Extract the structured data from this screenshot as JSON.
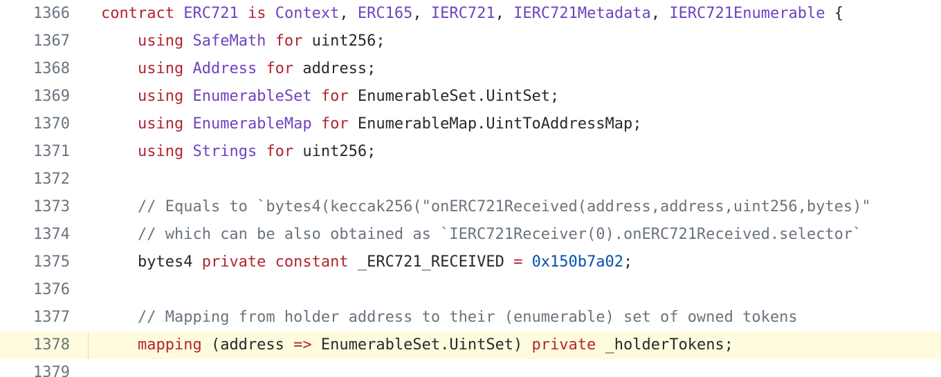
{
  "editor": {
    "lines": [
      {
        "number": "1366",
        "highlighted": false,
        "tokens": [
          {
            "text": "contract",
            "kind": "kw"
          },
          {
            "text": " ",
            "kind": "txt"
          },
          {
            "text": "ERC721",
            "kind": "cls"
          },
          {
            "text": " ",
            "kind": "txt"
          },
          {
            "text": "is",
            "kind": "kw"
          },
          {
            "text": " ",
            "kind": "txt"
          },
          {
            "text": "Context",
            "kind": "cls"
          },
          {
            "text": ", ",
            "kind": "txt"
          },
          {
            "text": "ERC165",
            "kind": "cls"
          },
          {
            "text": ", ",
            "kind": "txt"
          },
          {
            "text": "IERC721",
            "kind": "cls"
          },
          {
            "text": ", ",
            "kind": "txt"
          },
          {
            "text": "IERC721Metadata",
            "kind": "cls"
          },
          {
            "text": ", ",
            "kind": "txt"
          },
          {
            "text": "IERC721Enumerable",
            "kind": "cls"
          },
          {
            "text": " {",
            "kind": "txt"
          }
        ]
      },
      {
        "number": "1367",
        "highlighted": false,
        "tokens": [
          {
            "text": "    ",
            "kind": "indent"
          },
          {
            "text": "using",
            "kind": "kw"
          },
          {
            "text": " ",
            "kind": "txt"
          },
          {
            "text": "SafeMath",
            "kind": "cls"
          },
          {
            "text": " ",
            "kind": "txt"
          },
          {
            "text": "for",
            "kind": "kw"
          },
          {
            "text": " uint256;",
            "kind": "txt"
          }
        ]
      },
      {
        "number": "1368",
        "highlighted": false,
        "tokens": [
          {
            "text": "    ",
            "kind": "indent"
          },
          {
            "text": "using",
            "kind": "kw"
          },
          {
            "text": " ",
            "kind": "txt"
          },
          {
            "text": "Address",
            "kind": "cls"
          },
          {
            "text": " ",
            "kind": "txt"
          },
          {
            "text": "for",
            "kind": "kw"
          },
          {
            "text": " address;",
            "kind": "txt"
          }
        ]
      },
      {
        "number": "1369",
        "highlighted": false,
        "tokens": [
          {
            "text": "    ",
            "kind": "indent"
          },
          {
            "text": "using",
            "kind": "kw"
          },
          {
            "text": " ",
            "kind": "txt"
          },
          {
            "text": "EnumerableSet",
            "kind": "cls"
          },
          {
            "text": " ",
            "kind": "txt"
          },
          {
            "text": "for",
            "kind": "kw"
          },
          {
            "text": " EnumerableSet.UintSet;",
            "kind": "txt"
          }
        ]
      },
      {
        "number": "1370",
        "highlighted": false,
        "tokens": [
          {
            "text": "    ",
            "kind": "indent"
          },
          {
            "text": "using",
            "kind": "kw"
          },
          {
            "text": " ",
            "kind": "txt"
          },
          {
            "text": "EnumerableMap",
            "kind": "cls"
          },
          {
            "text": " ",
            "kind": "txt"
          },
          {
            "text": "for",
            "kind": "kw"
          },
          {
            "text": " EnumerableMap.UintToAddressMap;",
            "kind": "txt"
          }
        ]
      },
      {
        "number": "1371",
        "highlighted": false,
        "tokens": [
          {
            "text": "    ",
            "kind": "indent"
          },
          {
            "text": "using",
            "kind": "kw"
          },
          {
            "text": " ",
            "kind": "txt"
          },
          {
            "text": "Strings",
            "kind": "cls"
          },
          {
            "text": " ",
            "kind": "txt"
          },
          {
            "text": "for",
            "kind": "kw"
          },
          {
            "text": " uint256;",
            "kind": "txt"
          }
        ]
      },
      {
        "number": "1372",
        "highlighted": false,
        "tokens": []
      },
      {
        "number": "1373",
        "highlighted": false,
        "tokens": [
          {
            "text": "    ",
            "kind": "indent"
          },
          {
            "text": "// Equals to `bytes4(keccak256(\"onERC721Received(address,address,uint256,bytes)\"",
            "kind": "cmt"
          }
        ]
      },
      {
        "number": "1374",
        "highlighted": false,
        "tokens": [
          {
            "text": "    ",
            "kind": "indent"
          },
          {
            "text": "// which can be also obtained as `IERC721Receiver(0).onERC721Received.selector`",
            "kind": "cmt"
          }
        ]
      },
      {
        "number": "1375",
        "highlighted": false,
        "tokens": [
          {
            "text": "    ",
            "kind": "indent"
          },
          {
            "text": "bytes4 ",
            "kind": "txt"
          },
          {
            "text": "private",
            "kind": "kw"
          },
          {
            "text": " ",
            "kind": "txt"
          },
          {
            "text": "constant",
            "kind": "kw"
          },
          {
            "text": " _ERC721_RECEIVED ",
            "kind": "txt"
          },
          {
            "text": "=",
            "kind": "kw"
          },
          {
            "text": " ",
            "kind": "txt"
          },
          {
            "text": "0x150b7a02",
            "kind": "num"
          },
          {
            "text": ";",
            "kind": "txt"
          }
        ]
      },
      {
        "number": "1376",
        "highlighted": false,
        "tokens": []
      },
      {
        "number": "1377",
        "highlighted": false,
        "tokens": [
          {
            "text": "    ",
            "kind": "indent"
          },
          {
            "text": "// Mapping from holder address to their (enumerable) set of owned tokens",
            "kind": "cmt"
          }
        ]
      },
      {
        "number": "1378",
        "highlighted": true,
        "tokens": [
          {
            "text": "    ",
            "kind": "indent"
          },
          {
            "text": "mapping",
            "kind": "kw"
          },
          {
            "text": " (address ",
            "kind": "txt"
          },
          {
            "text": "=>",
            "kind": "kw"
          },
          {
            "text": " EnumerableSet.UintSet) ",
            "kind": "txt"
          },
          {
            "text": "private",
            "kind": "kw"
          },
          {
            "text": " _holderTokens;",
            "kind": "txt"
          }
        ]
      },
      {
        "number": "1379",
        "highlighted": false,
        "tokens": []
      }
    ]
  }
}
